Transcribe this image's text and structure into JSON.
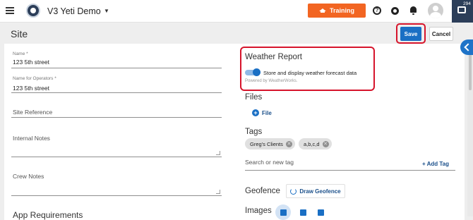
{
  "header": {
    "app_title": "V3 Yeti Demo",
    "training_label": "Training",
    "help_glyph": "?",
    "notification_count": "294",
    "icons": [
      "hamburger-menu-icon",
      "app-logo-icon",
      "chevron-down-icon",
      "graduation-cap-icon",
      "help-icon",
      "gear-icon",
      "bell-icon",
      "avatar",
      "chat-icon"
    ]
  },
  "page": {
    "title": "Site",
    "save_label": "Save",
    "cancel_label": "Cancel"
  },
  "form": {
    "name_label": "Name *",
    "name_value": "123 5th street",
    "operators_label": "Name for Operators *",
    "operators_value": "123 5th street",
    "site_reference_label": "Site Reference",
    "internal_notes_label": "Internal Notes",
    "crew_notes_label": "Crew Notes",
    "app_requirements_label": "App Requirements"
  },
  "weather": {
    "title": "Weather Report",
    "toggle_label": "Store and display weather forecast data",
    "toggle_on": true,
    "powered_by": "Powered by WeatherWorks."
  },
  "files": {
    "title": "Files",
    "add_label": "File"
  },
  "tags": {
    "title": "Tags",
    "items": [
      "Greg's Clients",
      "a,b,c,d"
    ],
    "input_placeholder": "Search or new tag",
    "add_label": "Add Tag",
    "add_prefix": "+"
  },
  "geofence": {
    "title": "Geofence",
    "draw_label": "Draw Geofence"
  },
  "images": {
    "title": "Images"
  },
  "colors": {
    "accent_blue": "#1a6fc4",
    "training_orange": "#f26522",
    "highlight_red": "#d6142b",
    "navy": "#2c3e59"
  }
}
